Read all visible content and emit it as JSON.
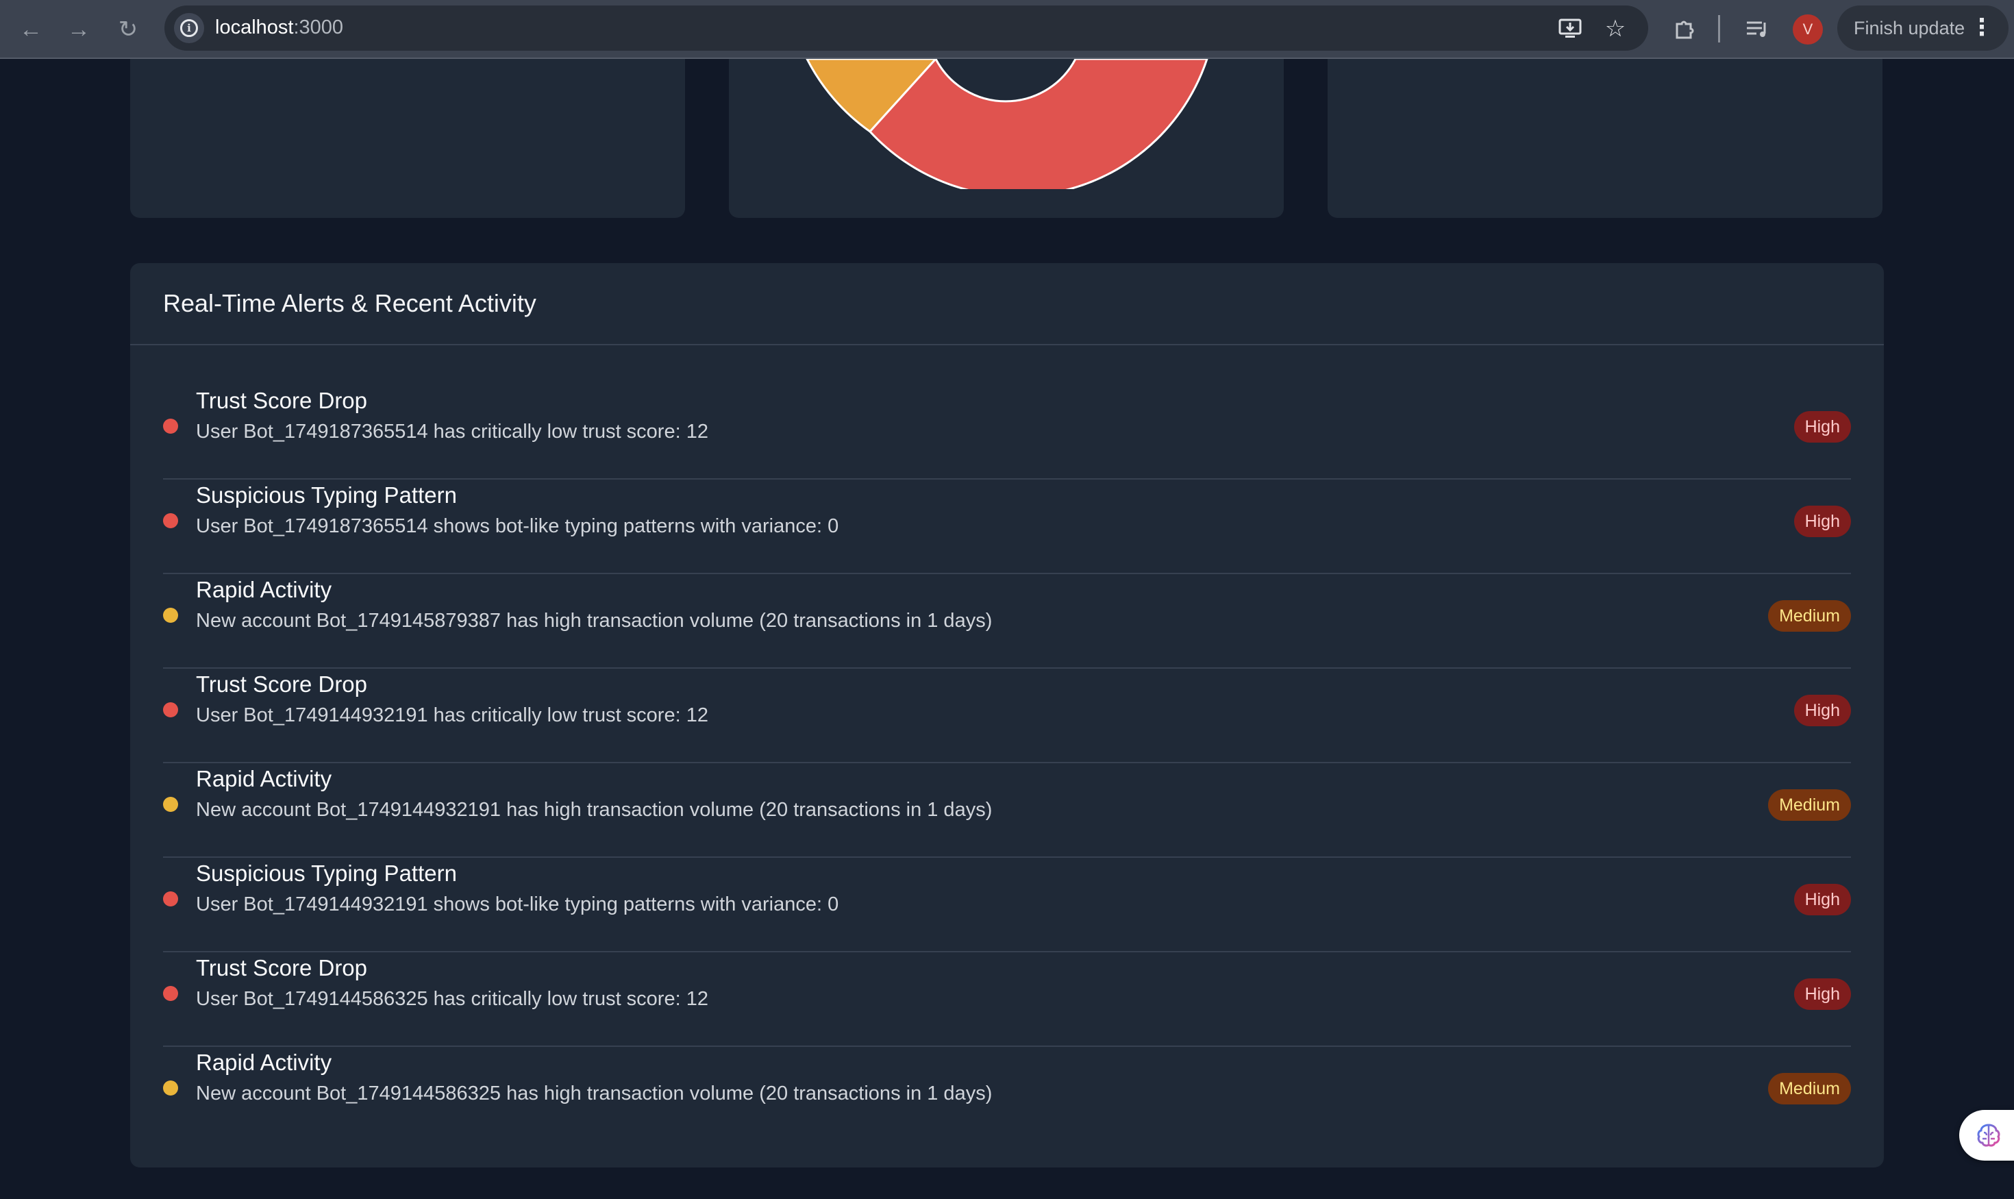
{
  "browser": {
    "url_host": "localhost",
    "url_port": ":3000",
    "finish_update_label": "Finish update",
    "avatar_initial": "V"
  },
  "chart_data": {
    "type": "pie",
    "series": [
      {
        "color": "#e8a23a"
      },
      {
        "color": "#e0534f"
      }
    ]
  },
  "alerts": {
    "title": "Real-Time Alerts & Recent Activity",
    "items": [
      {
        "title": "Trust Score Drop",
        "description": "User Bot_1749187365514 has critically low trust score: 12",
        "severity": "High",
        "color": "#e5534b"
      },
      {
        "title": "Suspicious Typing Pattern",
        "description": "User Bot_1749187365514 shows bot-like typing patterns with variance: 0",
        "severity": "High",
        "color": "#e5534b"
      },
      {
        "title": "Rapid Activity",
        "description": "New account Bot_1749145879387 has high transaction volume (20 transactions in 1 days)",
        "severity": "Medium",
        "color": "#eab53a"
      },
      {
        "title": "Trust Score Drop",
        "description": "User Bot_1749144932191 has critically low trust score: 12",
        "severity": "High",
        "color": "#e5534b"
      },
      {
        "title": "Rapid Activity",
        "description": "New account Bot_1749144932191 has high transaction volume (20 transactions in 1 days)",
        "severity": "Medium",
        "color": "#eab53a"
      },
      {
        "title": "Suspicious Typing Pattern",
        "description": "User Bot_1749144932191 shows bot-like typing patterns with variance: 0",
        "severity": "High",
        "color": "#e5534b"
      },
      {
        "title": "Trust Score Drop",
        "description": "User Bot_1749144586325 has critically low trust score: 12",
        "severity": "High",
        "color": "#e5534b"
      },
      {
        "title": "Rapid Activity",
        "description": "New account Bot_1749144586325 has high transaction volume (20 transactions in 1 days)",
        "severity": "Medium",
        "color": "#eab53a"
      }
    ]
  }
}
